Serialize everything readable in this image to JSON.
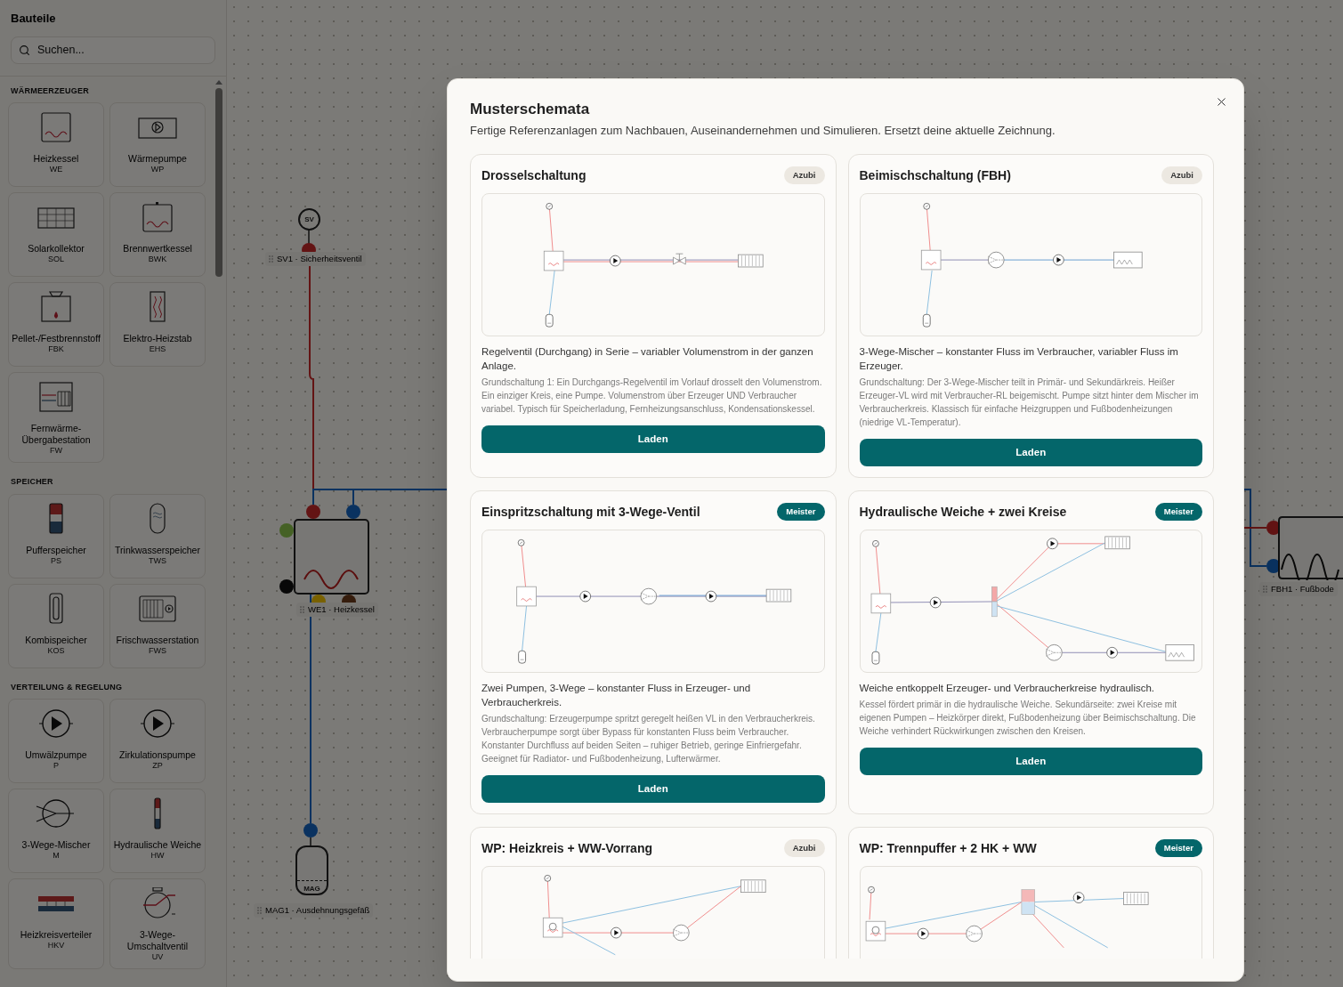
{
  "sidebar": {
    "title": "Bauteile",
    "search": {
      "placeholder": "Suchen..."
    },
    "sections": [
      {
        "title": "WÄRMEERZEUGER",
        "items": [
          {
            "name": "Heizkessel",
            "code": "WE"
          },
          {
            "name": "Wärmepumpe",
            "code": "WP"
          },
          {
            "name": "Solarkollektor",
            "code": "SOL"
          },
          {
            "name": "Brennwertkessel",
            "code": "BWK"
          },
          {
            "name": "Pellet-/Festbrennstoff",
            "code": "FBK"
          },
          {
            "name": "Elektro-Heizstab",
            "code": "EHS"
          },
          {
            "name": "Fernwärme-Übergabestation",
            "code": "FW"
          }
        ]
      },
      {
        "title": "SPEICHER",
        "items": [
          {
            "name": "Pufferspeicher",
            "code": "PS"
          },
          {
            "name": "Trinkwasserspeicher",
            "code": "TWS"
          },
          {
            "name": "Kombispeicher",
            "code": "KOS"
          },
          {
            "name": "Frischwasserstation",
            "code": "FWS"
          }
        ]
      },
      {
        "title": "VERTEILUNG & REGELUNG",
        "items": [
          {
            "name": "Umwälzpumpe",
            "code": "P"
          },
          {
            "name": "Zirkulationspumpe",
            "code": "ZP"
          },
          {
            "name": "3-Wege-Mischer",
            "code": "M"
          },
          {
            "name": "Hydraulische Weiche",
            "code": "HW"
          },
          {
            "name": "Heizkreisverteiler",
            "code": "HKV"
          },
          {
            "name": "3-Wege-Umschaltventil",
            "code": "UV"
          }
        ]
      }
    ]
  },
  "canvas": {
    "nodes": [
      {
        "label": "SV1 · Sicherheitsventil",
        "symbol": "SV"
      },
      {
        "label": "WE1 · Heizkessel"
      },
      {
        "label": "MAG1 · Ausdehnungsgefäß",
        "symbol": "MAG"
      },
      {
        "label": "FBH1 · Fußbode"
      }
    ]
  },
  "dialog": {
    "title": "Musterschemata",
    "subtitle": "Fertige Referenzanlagen zum Nachbauen, Auseinandernehmen und Simulieren. Ersetzt deine aktuelle Zeichnung.",
    "cards": [
      {
        "title": "Drosselschaltung",
        "badge": {
          "label": "Azubi",
          "kind": "basic"
        },
        "summary": "Regelventil (Durchgang) in Serie – variabler Volumenstrom in der ganzen Anlage.",
        "details": "Grundschaltung 1: Ein Durchgangs-Regelventil im Vorlauf drosselt den Volumenstrom. Ein einziger Kreis, eine Pumpe. Volumenstrom über Erzeuger UND Verbraucher variabel. Typisch für Speicherladung, Fernheizungsanschluss, Kondensationskessel.",
        "button": "Laden"
      },
      {
        "title": "Beimischschaltung (FBH)",
        "badge": {
          "label": "Azubi",
          "kind": "basic"
        },
        "summary": "3-Wege-Mischer – konstanter Fluss im Verbraucher, variabler Fluss im Erzeuger.",
        "details": "Grundschaltung: Der 3-Wege-Mischer teilt in Primär- und Sekundärkreis. Heißer Erzeuger-VL wird mit Verbraucher-RL beigemischt. Pumpe sitzt hinter dem Mischer im Verbraucherkreis. Klassisch für einfache Heizgruppen und Fußbodenheizungen (niedrige VL-Temperatur).",
        "button": "Laden"
      },
      {
        "title": "Einspritzschaltung mit 3-Wege-Ventil",
        "badge": {
          "label": "Meister",
          "kind": "advanced"
        },
        "summary": "Zwei Pumpen, 3-Wege – konstanter Fluss in Erzeuger- und Verbraucherkreis.",
        "details": "Grundschaltung: Erzeugerpumpe spritzt geregelt heißen VL in den Verbraucherkreis. Verbraucherpumpe sorgt über Bypass für konstanten Fluss beim Verbraucher. Konstanter Durchfluss auf beiden Seiten – ruhiger Betrieb, geringe Einfriergefahr. Geeignet für Radiator- und Fußbodenheizung, Lufterwärmer.",
        "button": "Laden"
      },
      {
        "title": "Hydraulische Weiche + zwei Kreise",
        "badge": {
          "label": "Meister",
          "kind": "advanced"
        },
        "summary": "Weiche entkoppelt Erzeuger- und Verbraucherkreise hydraulisch.",
        "details": "Kessel fördert primär in die hydraulische Weiche. Sekundärseite: zwei Kreise mit eigenen Pumpen – Heizkörper direkt, Fußbodenheizung über Beimischschaltung. Die Weiche verhindert Rückwirkungen zwischen den Kreisen.",
        "button": "Laden"
      },
      {
        "title": "WP: Heizkreis + WW-Vorrang",
        "badge": {
          "label": "Azubi",
          "kind": "basic"
        }
      },
      {
        "title": "WP: Trennpuffer + 2 HK + WW",
        "badge": {
          "label": "Meister",
          "kind": "advanced"
        }
      }
    ]
  }
}
